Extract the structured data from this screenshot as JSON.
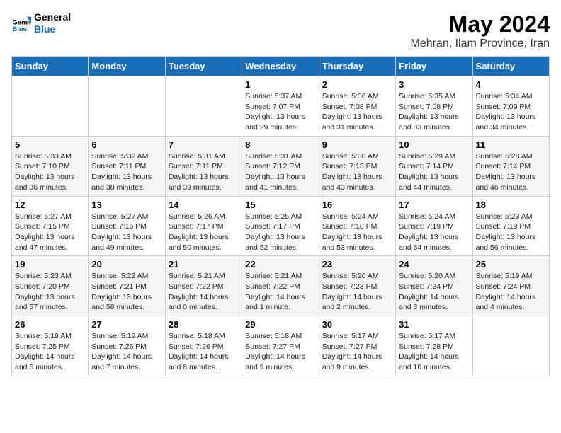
{
  "header": {
    "logo_general": "General",
    "logo_blue": "Blue",
    "month_title": "May 2024",
    "location": "Mehran, Ilam Province, Iran"
  },
  "days_of_week": [
    "Sunday",
    "Monday",
    "Tuesday",
    "Wednesday",
    "Thursday",
    "Friday",
    "Saturday"
  ],
  "weeks": [
    [
      {
        "num": "",
        "sunrise": "",
        "sunset": "",
        "daylight": ""
      },
      {
        "num": "",
        "sunrise": "",
        "sunset": "",
        "daylight": ""
      },
      {
        "num": "",
        "sunrise": "",
        "sunset": "",
        "daylight": ""
      },
      {
        "num": "1",
        "sunrise": "Sunrise: 5:37 AM",
        "sunset": "Sunset: 7:07 PM",
        "daylight": "Daylight: 13 hours and 29 minutes."
      },
      {
        "num": "2",
        "sunrise": "Sunrise: 5:36 AM",
        "sunset": "Sunset: 7:08 PM",
        "daylight": "Daylight: 13 hours and 31 minutes."
      },
      {
        "num": "3",
        "sunrise": "Sunrise: 5:35 AM",
        "sunset": "Sunset: 7:08 PM",
        "daylight": "Daylight: 13 hours and 33 minutes."
      },
      {
        "num": "4",
        "sunrise": "Sunrise: 5:34 AM",
        "sunset": "Sunset: 7:09 PM",
        "daylight": "Daylight: 13 hours and 34 minutes."
      }
    ],
    [
      {
        "num": "5",
        "sunrise": "Sunrise: 5:33 AM",
        "sunset": "Sunset: 7:10 PM",
        "daylight": "Daylight: 13 hours and 36 minutes."
      },
      {
        "num": "6",
        "sunrise": "Sunrise: 5:32 AM",
        "sunset": "Sunset: 7:11 PM",
        "daylight": "Daylight: 13 hours and 38 minutes."
      },
      {
        "num": "7",
        "sunrise": "Sunrise: 5:31 AM",
        "sunset": "Sunset: 7:11 PM",
        "daylight": "Daylight: 13 hours and 39 minutes."
      },
      {
        "num": "8",
        "sunrise": "Sunrise: 5:31 AM",
        "sunset": "Sunset: 7:12 PM",
        "daylight": "Daylight: 13 hours and 41 minutes."
      },
      {
        "num": "9",
        "sunrise": "Sunrise: 5:30 AM",
        "sunset": "Sunset: 7:13 PM",
        "daylight": "Daylight: 13 hours and 43 minutes."
      },
      {
        "num": "10",
        "sunrise": "Sunrise: 5:29 AM",
        "sunset": "Sunset: 7:14 PM",
        "daylight": "Daylight: 13 hours and 44 minutes."
      },
      {
        "num": "11",
        "sunrise": "Sunrise: 5:28 AM",
        "sunset": "Sunset: 7:14 PM",
        "daylight": "Daylight: 13 hours and 46 minutes."
      }
    ],
    [
      {
        "num": "12",
        "sunrise": "Sunrise: 5:27 AM",
        "sunset": "Sunset: 7:15 PM",
        "daylight": "Daylight: 13 hours and 47 minutes."
      },
      {
        "num": "13",
        "sunrise": "Sunrise: 5:27 AM",
        "sunset": "Sunset: 7:16 PM",
        "daylight": "Daylight: 13 hours and 49 minutes."
      },
      {
        "num": "14",
        "sunrise": "Sunrise: 5:26 AM",
        "sunset": "Sunset: 7:17 PM",
        "daylight": "Daylight: 13 hours and 50 minutes."
      },
      {
        "num": "15",
        "sunrise": "Sunrise: 5:25 AM",
        "sunset": "Sunset: 7:17 PM",
        "daylight": "Daylight: 13 hours and 52 minutes."
      },
      {
        "num": "16",
        "sunrise": "Sunrise: 5:24 AM",
        "sunset": "Sunset: 7:18 PM",
        "daylight": "Daylight: 13 hours and 53 minutes."
      },
      {
        "num": "17",
        "sunrise": "Sunrise: 5:24 AM",
        "sunset": "Sunset: 7:19 PM",
        "daylight": "Daylight: 13 hours and 54 minutes."
      },
      {
        "num": "18",
        "sunrise": "Sunrise: 5:23 AM",
        "sunset": "Sunset: 7:19 PM",
        "daylight": "Daylight: 13 hours and 56 minutes."
      }
    ],
    [
      {
        "num": "19",
        "sunrise": "Sunrise: 5:23 AM",
        "sunset": "Sunset: 7:20 PM",
        "daylight": "Daylight: 13 hours and 57 minutes."
      },
      {
        "num": "20",
        "sunrise": "Sunrise: 5:22 AM",
        "sunset": "Sunset: 7:21 PM",
        "daylight": "Daylight: 13 hours and 58 minutes."
      },
      {
        "num": "21",
        "sunrise": "Sunrise: 5:21 AM",
        "sunset": "Sunset: 7:22 PM",
        "daylight": "Daylight: 14 hours and 0 minutes."
      },
      {
        "num": "22",
        "sunrise": "Sunrise: 5:21 AM",
        "sunset": "Sunset: 7:22 PM",
        "daylight": "Daylight: 14 hours and 1 minute."
      },
      {
        "num": "23",
        "sunrise": "Sunrise: 5:20 AM",
        "sunset": "Sunset: 7:23 PM",
        "daylight": "Daylight: 14 hours and 2 minutes."
      },
      {
        "num": "24",
        "sunrise": "Sunrise: 5:20 AM",
        "sunset": "Sunset: 7:24 PM",
        "daylight": "Daylight: 14 hours and 3 minutes."
      },
      {
        "num": "25",
        "sunrise": "Sunrise: 5:19 AM",
        "sunset": "Sunset: 7:24 PM",
        "daylight": "Daylight: 14 hours and 4 minutes."
      }
    ],
    [
      {
        "num": "26",
        "sunrise": "Sunrise: 5:19 AM",
        "sunset": "Sunset: 7:25 PM",
        "daylight": "Daylight: 14 hours and 5 minutes."
      },
      {
        "num": "27",
        "sunrise": "Sunrise: 5:19 AM",
        "sunset": "Sunset: 7:26 PM",
        "daylight": "Daylight: 14 hours and 7 minutes."
      },
      {
        "num": "28",
        "sunrise": "Sunrise: 5:18 AM",
        "sunset": "Sunset: 7:26 PM",
        "daylight": "Daylight: 14 hours and 8 minutes."
      },
      {
        "num": "29",
        "sunrise": "Sunrise: 5:18 AM",
        "sunset": "Sunset: 7:27 PM",
        "daylight": "Daylight: 14 hours and 9 minutes."
      },
      {
        "num": "30",
        "sunrise": "Sunrise: 5:17 AM",
        "sunset": "Sunset: 7:27 PM",
        "daylight": "Daylight: 14 hours and 9 minutes."
      },
      {
        "num": "31",
        "sunrise": "Sunrise: 5:17 AM",
        "sunset": "Sunset: 7:28 PM",
        "daylight": "Daylight: 14 hours and 10 minutes."
      },
      {
        "num": "",
        "sunrise": "",
        "sunset": "",
        "daylight": ""
      }
    ]
  ]
}
